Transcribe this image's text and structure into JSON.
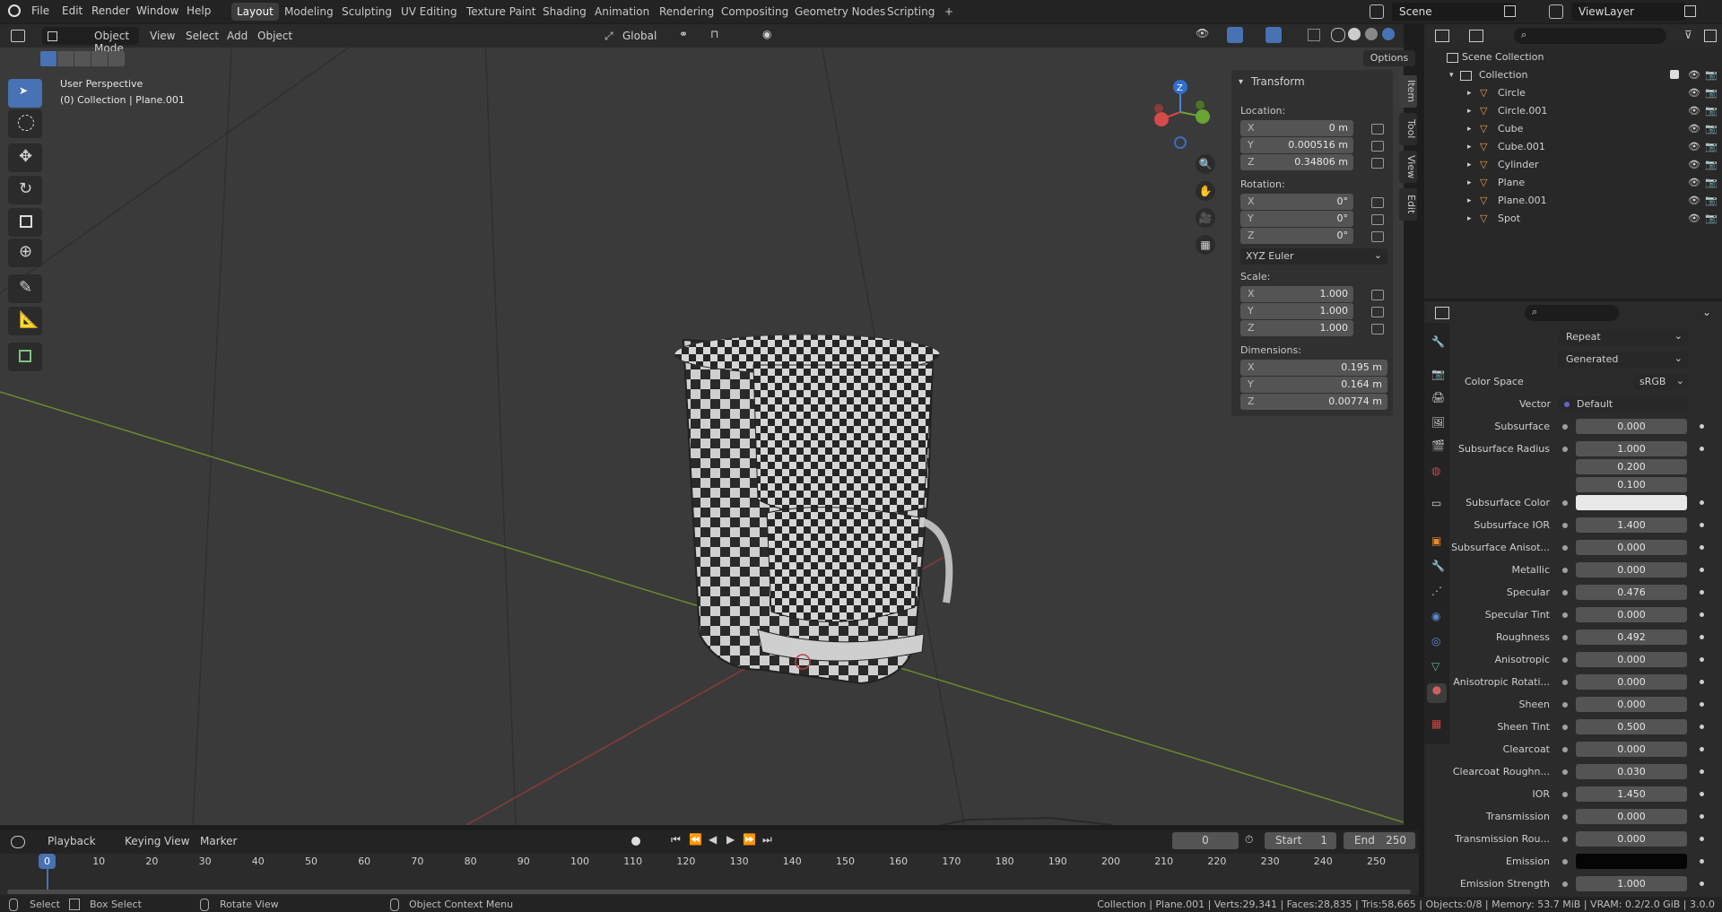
{
  "topbar": {
    "menus": [
      "File",
      "Edit",
      "Render",
      "Window",
      "Help"
    ],
    "workspaces": [
      "Layout",
      "Modeling",
      "Sculpting",
      "UV Editing",
      "Texture Paint",
      "Shading",
      "Animation",
      "Rendering",
      "Compositing",
      "Geometry Nodes",
      "Scripting"
    ],
    "active_workspace": "Layout",
    "add_tab": "+",
    "scene": "Scene",
    "view_layer": "ViewLayer"
  },
  "viewport": {
    "mode": "Object Mode",
    "menus": [
      "View",
      "Select",
      "Add",
      "Object"
    ],
    "orientation": "Global",
    "options": "Options",
    "overlay_line1": "User Perspective",
    "overlay_line2": "(0) Collection | Plane.001",
    "gizmo_labels": [
      "Z"
    ]
  },
  "npanel": {
    "title": "Transform",
    "location_label": "Location:",
    "location": [
      {
        "axis": "X",
        "value": "0 m"
      },
      {
        "axis": "Y",
        "value": "0.000516 m"
      },
      {
        "axis": "Z",
        "value": "0.34806 m"
      }
    ],
    "rotation_label": "Rotation:",
    "rotation": [
      {
        "axis": "X",
        "value": "0°"
      },
      {
        "axis": "Y",
        "value": "0°"
      },
      {
        "axis": "Z",
        "value": "0°"
      }
    ],
    "rotation_mode": "XYZ Euler",
    "scale_label": "Scale:",
    "scale": [
      {
        "axis": "X",
        "value": "1.000"
      },
      {
        "axis": "Y",
        "value": "1.000"
      },
      {
        "axis": "Z",
        "value": "1.000"
      }
    ],
    "dimensions_label": "Dimensions:",
    "dimensions": [
      {
        "axis": "X",
        "value": "0.195 m"
      },
      {
        "axis": "Y",
        "value": "0.164 m"
      },
      {
        "axis": "Z",
        "value": "0.00774 m"
      }
    ],
    "tabs": [
      "Item",
      "Tool",
      "View",
      "Edit"
    ]
  },
  "outliner": {
    "root": "Scene Collection",
    "collection": "Collection",
    "items": [
      "Circle",
      "Circle.001",
      "Cube",
      "Cube.001",
      "Cylinder",
      "Plane",
      "Plane.001",
      "Spot"
    ]
  },
  "properties": {
    "extension": "Repeat",
    "projection": "Generated",
    "color_space_label": "Color Space",
    "color_space": "sRGB",
    "vector_label": "Vector",
    "vector": "Default",
    "rows": [
      {
        "label": "Subsurface",
        "value": "0.000",
        "fill": 0
      },
      {
        "label": "Subsurface Radius",
        "value": "1.000",
        "fill": 0
      },
      {
        "label": "",
        "value": "0.200",
        "fill": 0
      },
      {
        "label": "",
        "value": "0.100",
        "fill": 0
      },
      {
        "label": "Subsurface Color",
        "value": "",
        "fill": 0,
        "swatch": "#e8e8e8"
      },
      {
        "label": "Subsurface IOR",
        "value": "1.400",
        "fill": 0.1
      },
      {
        "label": "Subsurface Anisot...",
        "value": "0.000",
        "fill": 0
      },
      {
        "label": "Metallic",
        "value": "0.000",
        "fill": 0
      },
      {
        "label": "Specular",
        "value": "0.476",
        "fill": 0.476
      },
      {
        "label": "Specular Tint",
        "value": "0.000",
        "fill": 0
      },
      {
        "label": "Roughness",
        "value": "0.492",
        "fill": 0.492
      },
      {
        "label": "Anisotropic",
        "value": "0.000",
        "fill": 0
      },
      {
        "label": "Anisotropic Rotati...",
        "value": "0.000",
        "fill": 0
      },
      {
        "label": "Sheen",
        "value": "0.000",
        "fill": 0
      },
      {
        "label": "Sheen Tint",
        "value": "0.500",
        "fill": 0.5
      },
      {
        "label": "Clearcoat",
        "value": "0.000",
        "fill": 0
      },
      {
        "label": "Clearcoat Roughn...",
        "value": "0.030",
        "fill": 0.03
      },
      {
        "label": "IOR",
        "value": "1.450",
        "fill": 0
      },
      {
        "label": "Transmission",
        "value": "0.000",
        "fill": 0
      },
      {
        "label": "Transmission Rou...",
        "value": "0.000",
        "fill": 0
      },
      {
        "label": "Emission",
        "value": "",
        "fill": 0,
        "swatch": "#050505"
      },
      {
        "label": "Emission Strength",
        "value": "1.000",
        "fill": 0
      }
    ]
  },
  "timeline": {
    "menus": [
      "Playback",
      "Keying",
      "View",
      "Marker"
    ],
    "current_frame": "0",
    "start_label": "Start",
    "start": "1",
    "end_label": "End",
    "end": "250",
    "ruler": [
      "0",
      "10",
      "20",
      "30",
      "40",
      "50",
      "60",
      "70",
      "80",
      "90",
      "100",
      "110",
      "120",
      "130",
      "140",
      "150",
      "160",
      "170",
      "180",
      "190",
      "200",
      "210",
      "220",
      "230",
      "240",
      "250"
    ]
  },
  "status": {
    "select": "Select",
    "box_select": "Box Select",
    "rotate_view": "Rotate View",
    "context_menu": "Object Context Menu",
    "stats": "Collection | Plane.001 | Verts:29,341 | Faces:28,835 | Tris:58,665 | Objects:0/8 | Memory: 53.7 MiB | VRAM: 0.2/2.0 GiB | 3.0.0"
  },
  "colors": {
    "accent": "#4772b3",
    "viewport_bg": "#3a3a3a",
    "panel_bg": "#303030"
  }
}
